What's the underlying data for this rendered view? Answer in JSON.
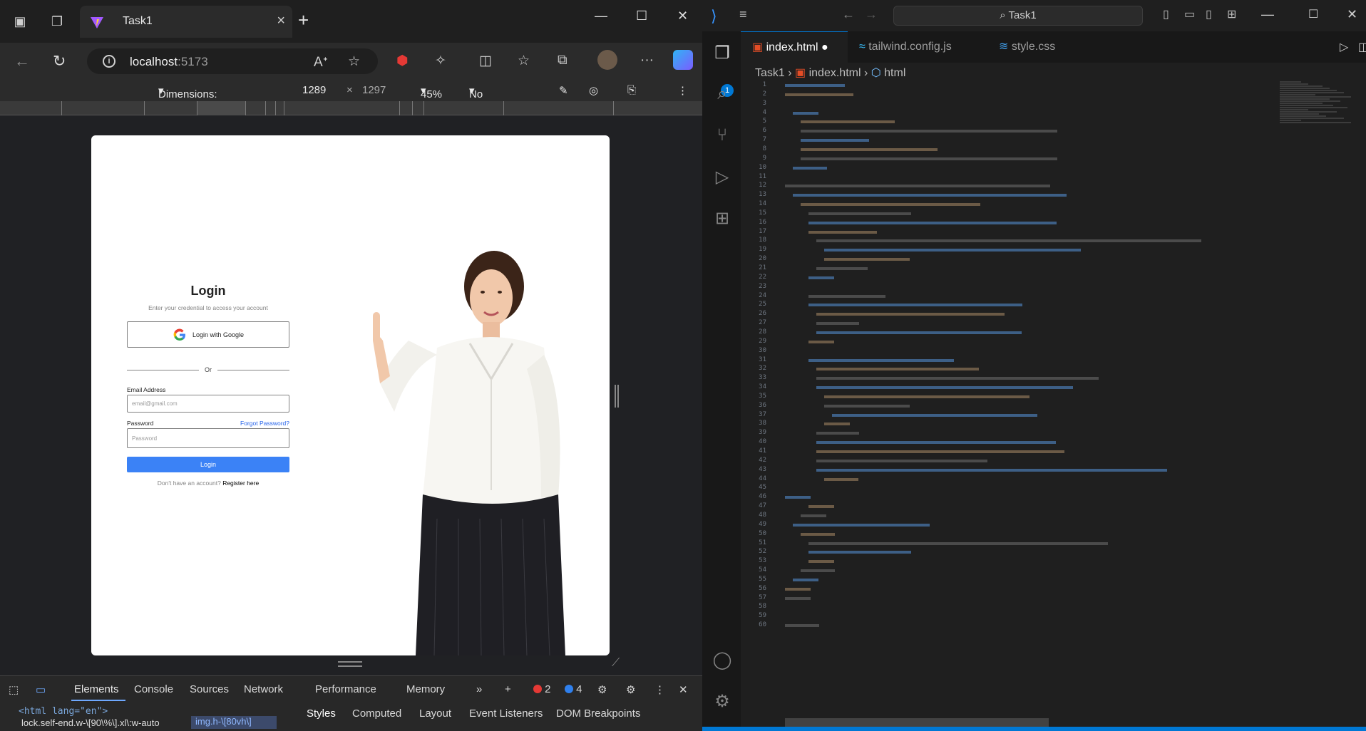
{
  "browser": {
    "tab_title": "Task1",
    "url_host": "localhost",
    "url_port": ":5173",
    "device_toolbar": {
      "dimensions_label": "Dimensions: Responsive",
      "width": "1289",
      "times": "×",
      "height": "1297",
      "zoom": "45%",
      "throttling": "No throttling"
    }
  },
  "login_page": {
    "title": "Login",
    "subtitle": "Enter your credential to access your account",
    "google_button": "Login with Google",
    "divider_text": "Or",
    "email_label": "Email Address",
    "email_placeholder": "email@gmail.com",
    "password_label": "Password",
    "forgot_link": "Forgot Password?",
    "password_placeholder": "Password",
    "submit_button": "Login",
    "register_prompt": "Don't have an account?",
    "register_link": "Register here"
  },
  "devtools": {
    "tabs": [
      "Elements",
      "Console",
      "Sources",
      "Network",
      "Performance",
      "Memory"
    ],
    "error_count": "2",
    "message_count": "4",
    "code_line_1": "<html lang=\"en\">",
    "breadcrumb_1": "lock.self-end.w-\\[90\\%\\].xl\\:w-auto",
    "breadcrumb_2": "img.h-\\[80vh\\]",
    "sub_tabs": [
      "Styles",
      "Computed",
      "Layout",
      "Event Listeners",
      "DOM Breakpoints"
    ]
  },
  "vscode": {
    "search_text": "Task1",
    "editor_tabs": [
      "index.html",
      "tailwind.config.js",
      "style.css"
    ],
    "breadcrumb": [
      "Task1",
      "index.html",
      "html"
    ],
    "explorer_badge": "1"
  },
  "colors": {
    "accent": "#3b82f6",
    "link": "#2563eb",
    "border": "#828282",
    "vscode_blue": "#0078d4"
  }
}
